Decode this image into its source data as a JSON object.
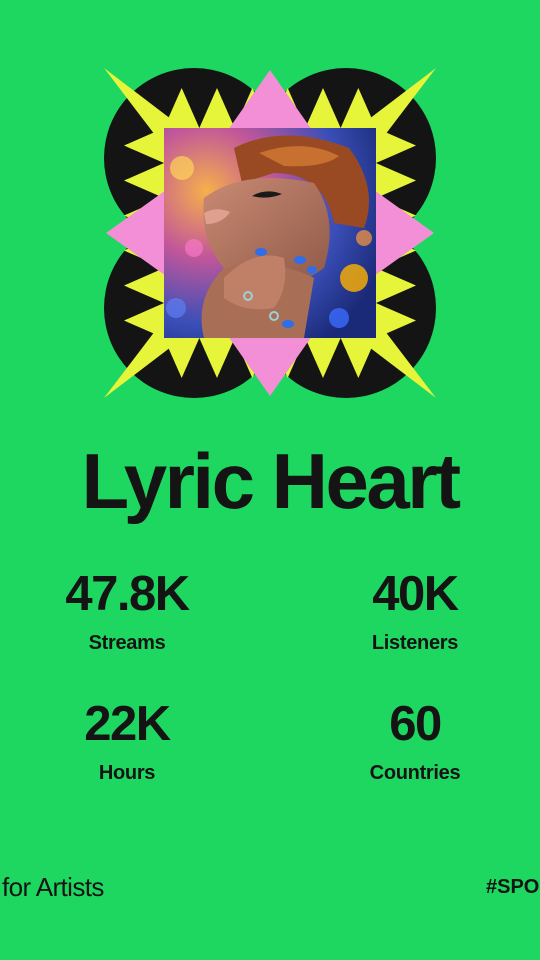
{
  "artist": {
    "name": "Lyric Heart"
  },
  "stats": [
    {
      "value": "47.8K",
      "label": "Streams"
    },
    {
      "value": "40K",
      "label": "Listeners"
    },
    {
      "value": "22K",
      "label": "Hours"
    },
    {
      "value": "60",
      "label": "Countries"
    }
  ],
  "footer": {
    "brand_text": "for Artists",
    "hashtag": "#SPO"
  },
  "colors": {
    "background": "#1ed760",
    "frame_black": "#141414",
    "burst_yellow": "#e6f53a",
    "burst_pink": "#f28fd6",
    "text": "#141414"
  },
  "icons": {
    "artwork_frame": "starburst-frame-icon"
  }
}
